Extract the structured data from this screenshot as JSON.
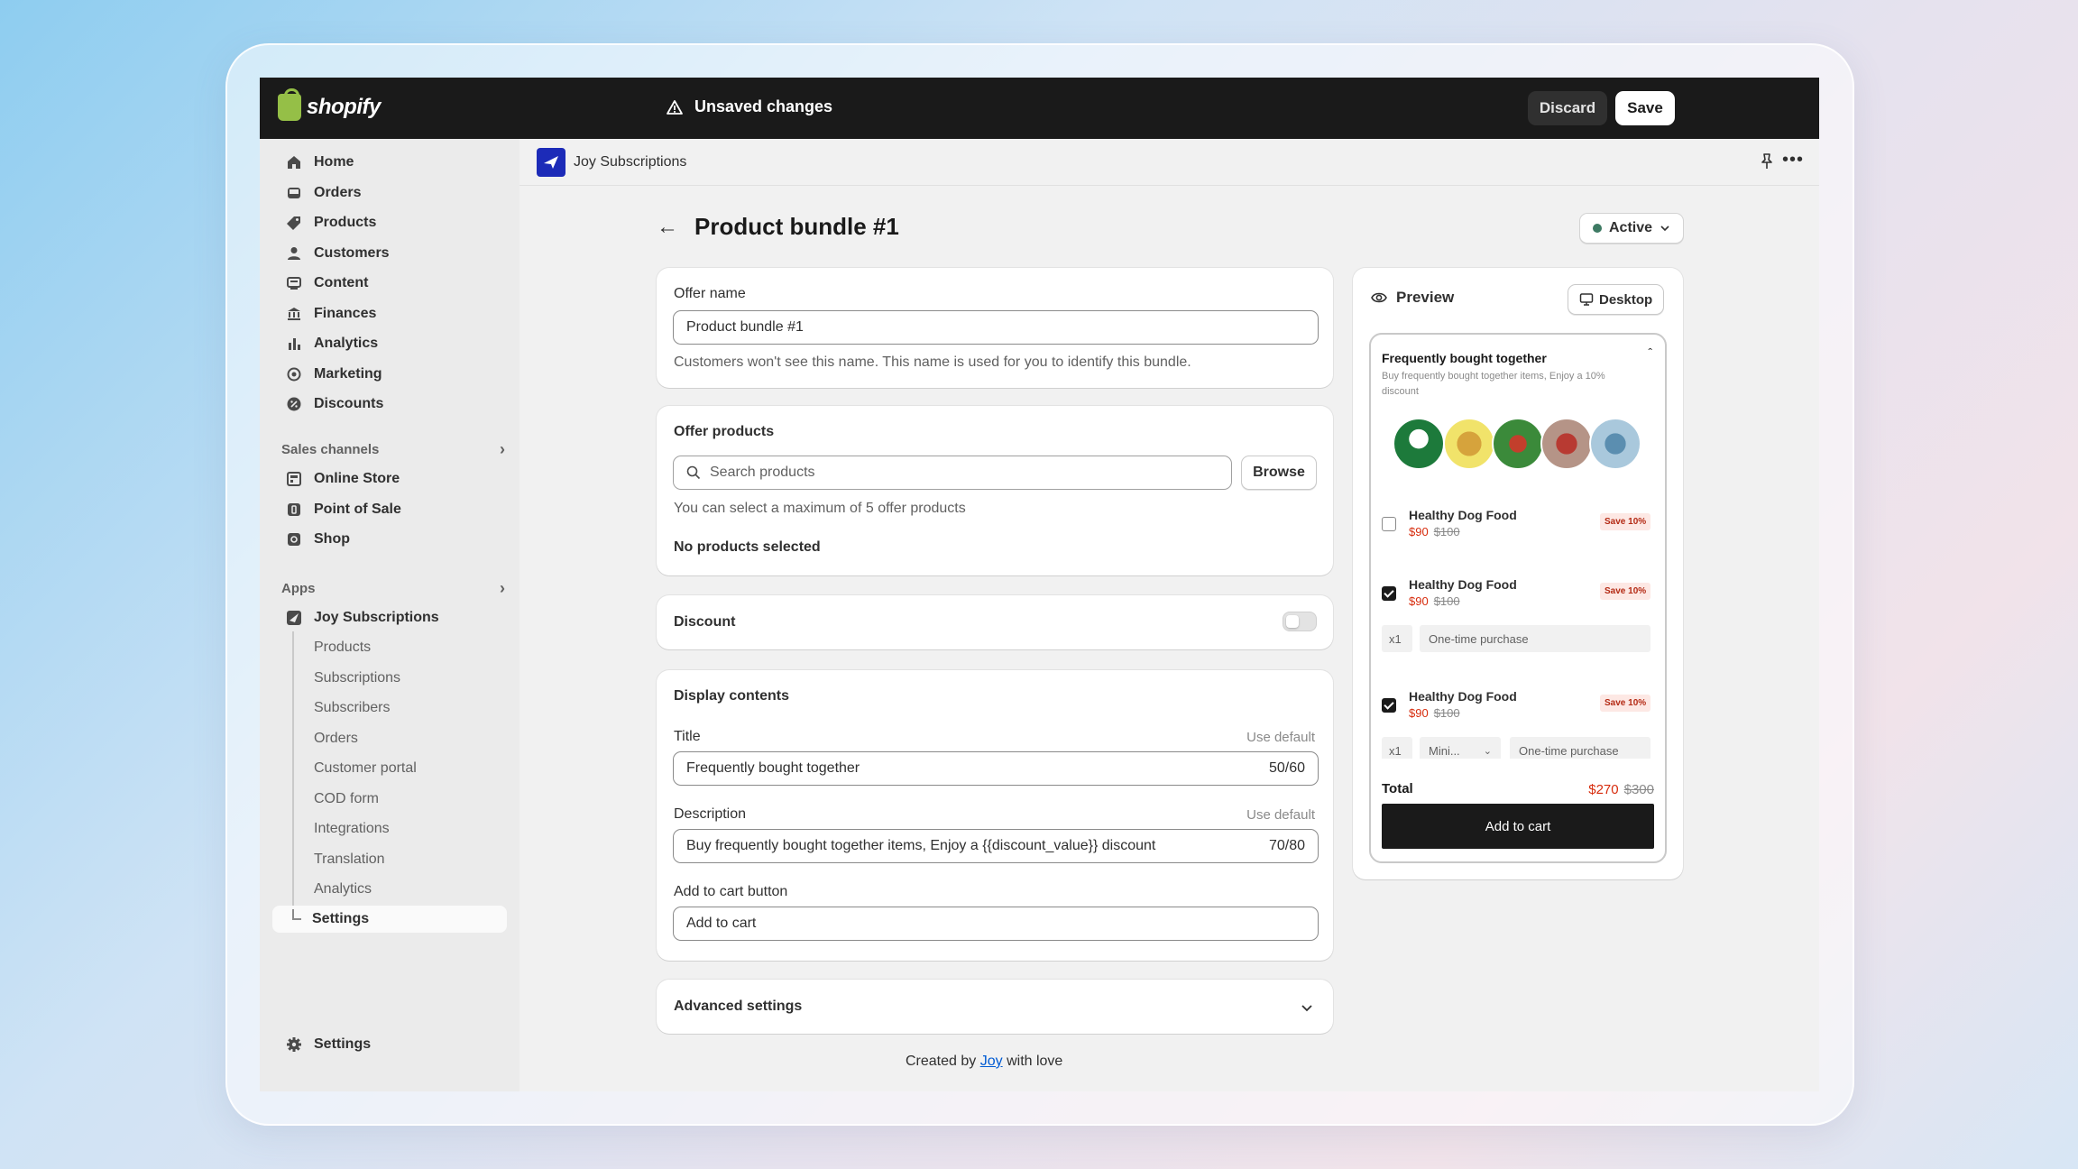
{
  "topbar": {
    "brand": "shopify",
    "unsaved": "Unsaved changes",
    "discard": "Discard",
    "save": "Save"
  },
  "sidebar": {
    "items": [
      {
        "label": "Home",
        "icon": "home-icon"
      },
      {
        "label": "Orders",
        "icon": "inbox-icon"
      },
      {
        "label": "Products",
        "icon": "tag-icon"
      },
      {
        "label": "Customers",
        "icon": "person-icon"
      },
      {
        "label": "Content",
        "icon": "content-icon"
      },
      {
        "label": "Finances",
        "icon": "bank-icon"
      },
      {
        "label": "Analytics",
        "icon": "bar-chart-icon"
      },
      {
        "label": "Marketing",
        "icon": "target-icon"
      },
      {
        "label": "Discounts",
        "icon": "discount-icon"
      }
    ],
    "sales_channels_label": "Sales channels",
    "channels": [
      {
        "label": "Online Store",
        "icon": "store-icon"
      },
      {
        "label": "Point of Sale",
        "icon": "pos-icon"
      },
      {
        "label": "Shop",
        "icon": "shop-icon"
      }
    ],
    "apps_label": "Apps",
    "app_name": "Joy Subscriptions",
    "app_sub": [
      "Products",
      "Subscriptions",
      "Subscribers",
      "Orders",
      "Customer portal",
      "COD form",
      "Integrations",
      "Translation",
      "Analytics",
      "Settings"
    ],
    "settings": "Settings"
  },
  "appbar": {
    "title": "Joy Subscriptions"
  },
  "page": {
    "title": "Product bundle #1",
    "status": "Active"
  },
  "offer_name": {
    "title": "Offer name",
    "value": "Product bundle #1",
    "help": "Customers won't see this name. This name is used for you to identify this bundle."
  },
  "offer_products": {
    "title": "Offer products",
    "placeholder": "Search products",
    "browse": "Browse",
    "help": "You can select a maximum of 5 offer products",
    "empty": "No products selected"
  },
  "discount": {
    "title": "Discount"
  },
  "display": {
    "title": "Display contents",
    "title_label": "Title",
    "use_default": "Use default",
    "title_value": "Frequently bought together",
    "title_count": "50/60",
    "desc_label": "Description",
    "desc_value": "Buy frequently bought together items, Enjoy a {{discount_value}} discount",
    "desc_count": "70/80",
    "cart_label": "Add to cart button",
    "cart_value": "Add to cart"
  },
  "advanced": {
    "title": "Advanced settings"
  },
  "footer": {
    "before": "Created by",
    "link": "Joy",
    "after": "with love"
  },
  "preview": {
    "title": "Preview",
    "device": "Desktop",
    "widget_title": "Frequently bought together",
    "widget_desc": "Buy frequently bought together items, Enjoy a 10% discount",
    "products": [
      {
        "name": "Healthy Dog Food",
        "price": "$90",
        "compare": "$100",
        "badge": "Save 10%",
        "checked": false
      },
      {
        "name": "Healthy Dog Food",
        "price": "$90",
        "compare": "$100",
        "badge": "Save 10%",
        "checked": true
      },
      {
        "name": "Healthy Dog Food",
        "price": "$90",
        "compare": "$100",
        "badge": "Save 10%",
        "checked": true
      }
    ],
    "qty": "x1",
    "purchase_type": "One-time purchase",
    "variant": "Mini...",
    "total_label": "Total",
    "total": "$270",
    "total_compare": "$300",
    "add_to_cart": "Add to cart"
  },
  "colors": {
    "accent": "#1a1a1a",
    "sale": "#d72c0d",
    "link": "#005bd3",
    "active": "#3d7a63"
  }
}
